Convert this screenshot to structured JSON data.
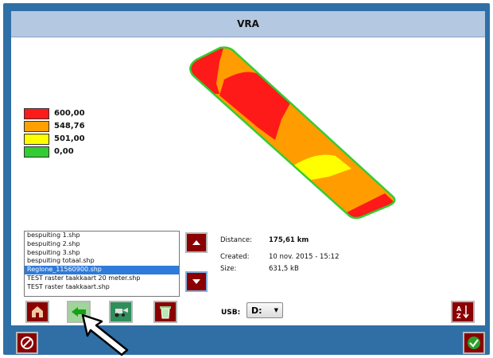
{
  "window": {
    "title": "VRA"
  },
  "legend": [
    {
      "color": "#ff1a1a",
      "value": "600,00"
    },
    {
      "color": "#ffa000",
      "value": "548,76"
    },
    {
      "color": "#ffff00",
      "value": "501,00"
    },
    {
      "color": "#33cc33",
      "value": "0,00"
    }
  ],
  "files": [
    "bespuiting 1.shp",
    "bespuiting 2.shp",
    "bespuiting 3.shp",
    "bespuiting totaal.shp",
    "Reglone_11560900.shp",
    "TEST raster taakkaart 20 meter.shp",
    "TEST raster taakkaart.shp"
  ],
  "selected_file_index": 4,
  "info": {
    "distance_label": "Distance:",
    "distance_value": "175,61 km",
    "created_label": "Created:",
    "created_value": "10 nov. 2015 - 15:12",
    "size_label": "Size:",
    "size_value": "631,5 kB"
  },
  "usb": {
    "label": "USB:",
    "value": "D:"
  },
  "icons": {
    "scroll_up": "triangle-up-icon",
    "scroll_down": "triangle-down-icon",
    "home": "field-home-icon",
    "back": "arrow-left-icon",
    "tractor": "tractor-icon",
    "trash": "trash-icon",
    "sort": "sort-az-icon",
    "cancel": "cancel-icon",
    "confirm": "checkmark-icon"
  }
}
